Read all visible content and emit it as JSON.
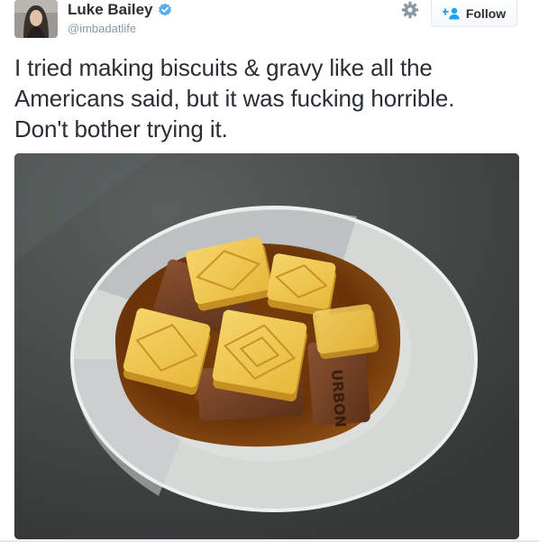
{
  "user": {
    "name": "Luke Bailey",
    "handle": "@imbadatlife",
    "verified": true
  },
  "actions": {
    "settings_icon": "gear-icon",
    "follow_label": "Follow",
    "follow_icon": "add-user-icon"
  },
  "tweet": {
    "lines": [
      "I tried making biscuits & gravy like all the",
      "Americans said, but it was fucking horrible.",
      "Don't bother trying it."
    ],
    "biscuit_stamp": "URBON"
  },
  "colors": {
    "accent": "#1da1f2",
    "text": "#292f33",
    "muted": "#8899a6"
  }
}
